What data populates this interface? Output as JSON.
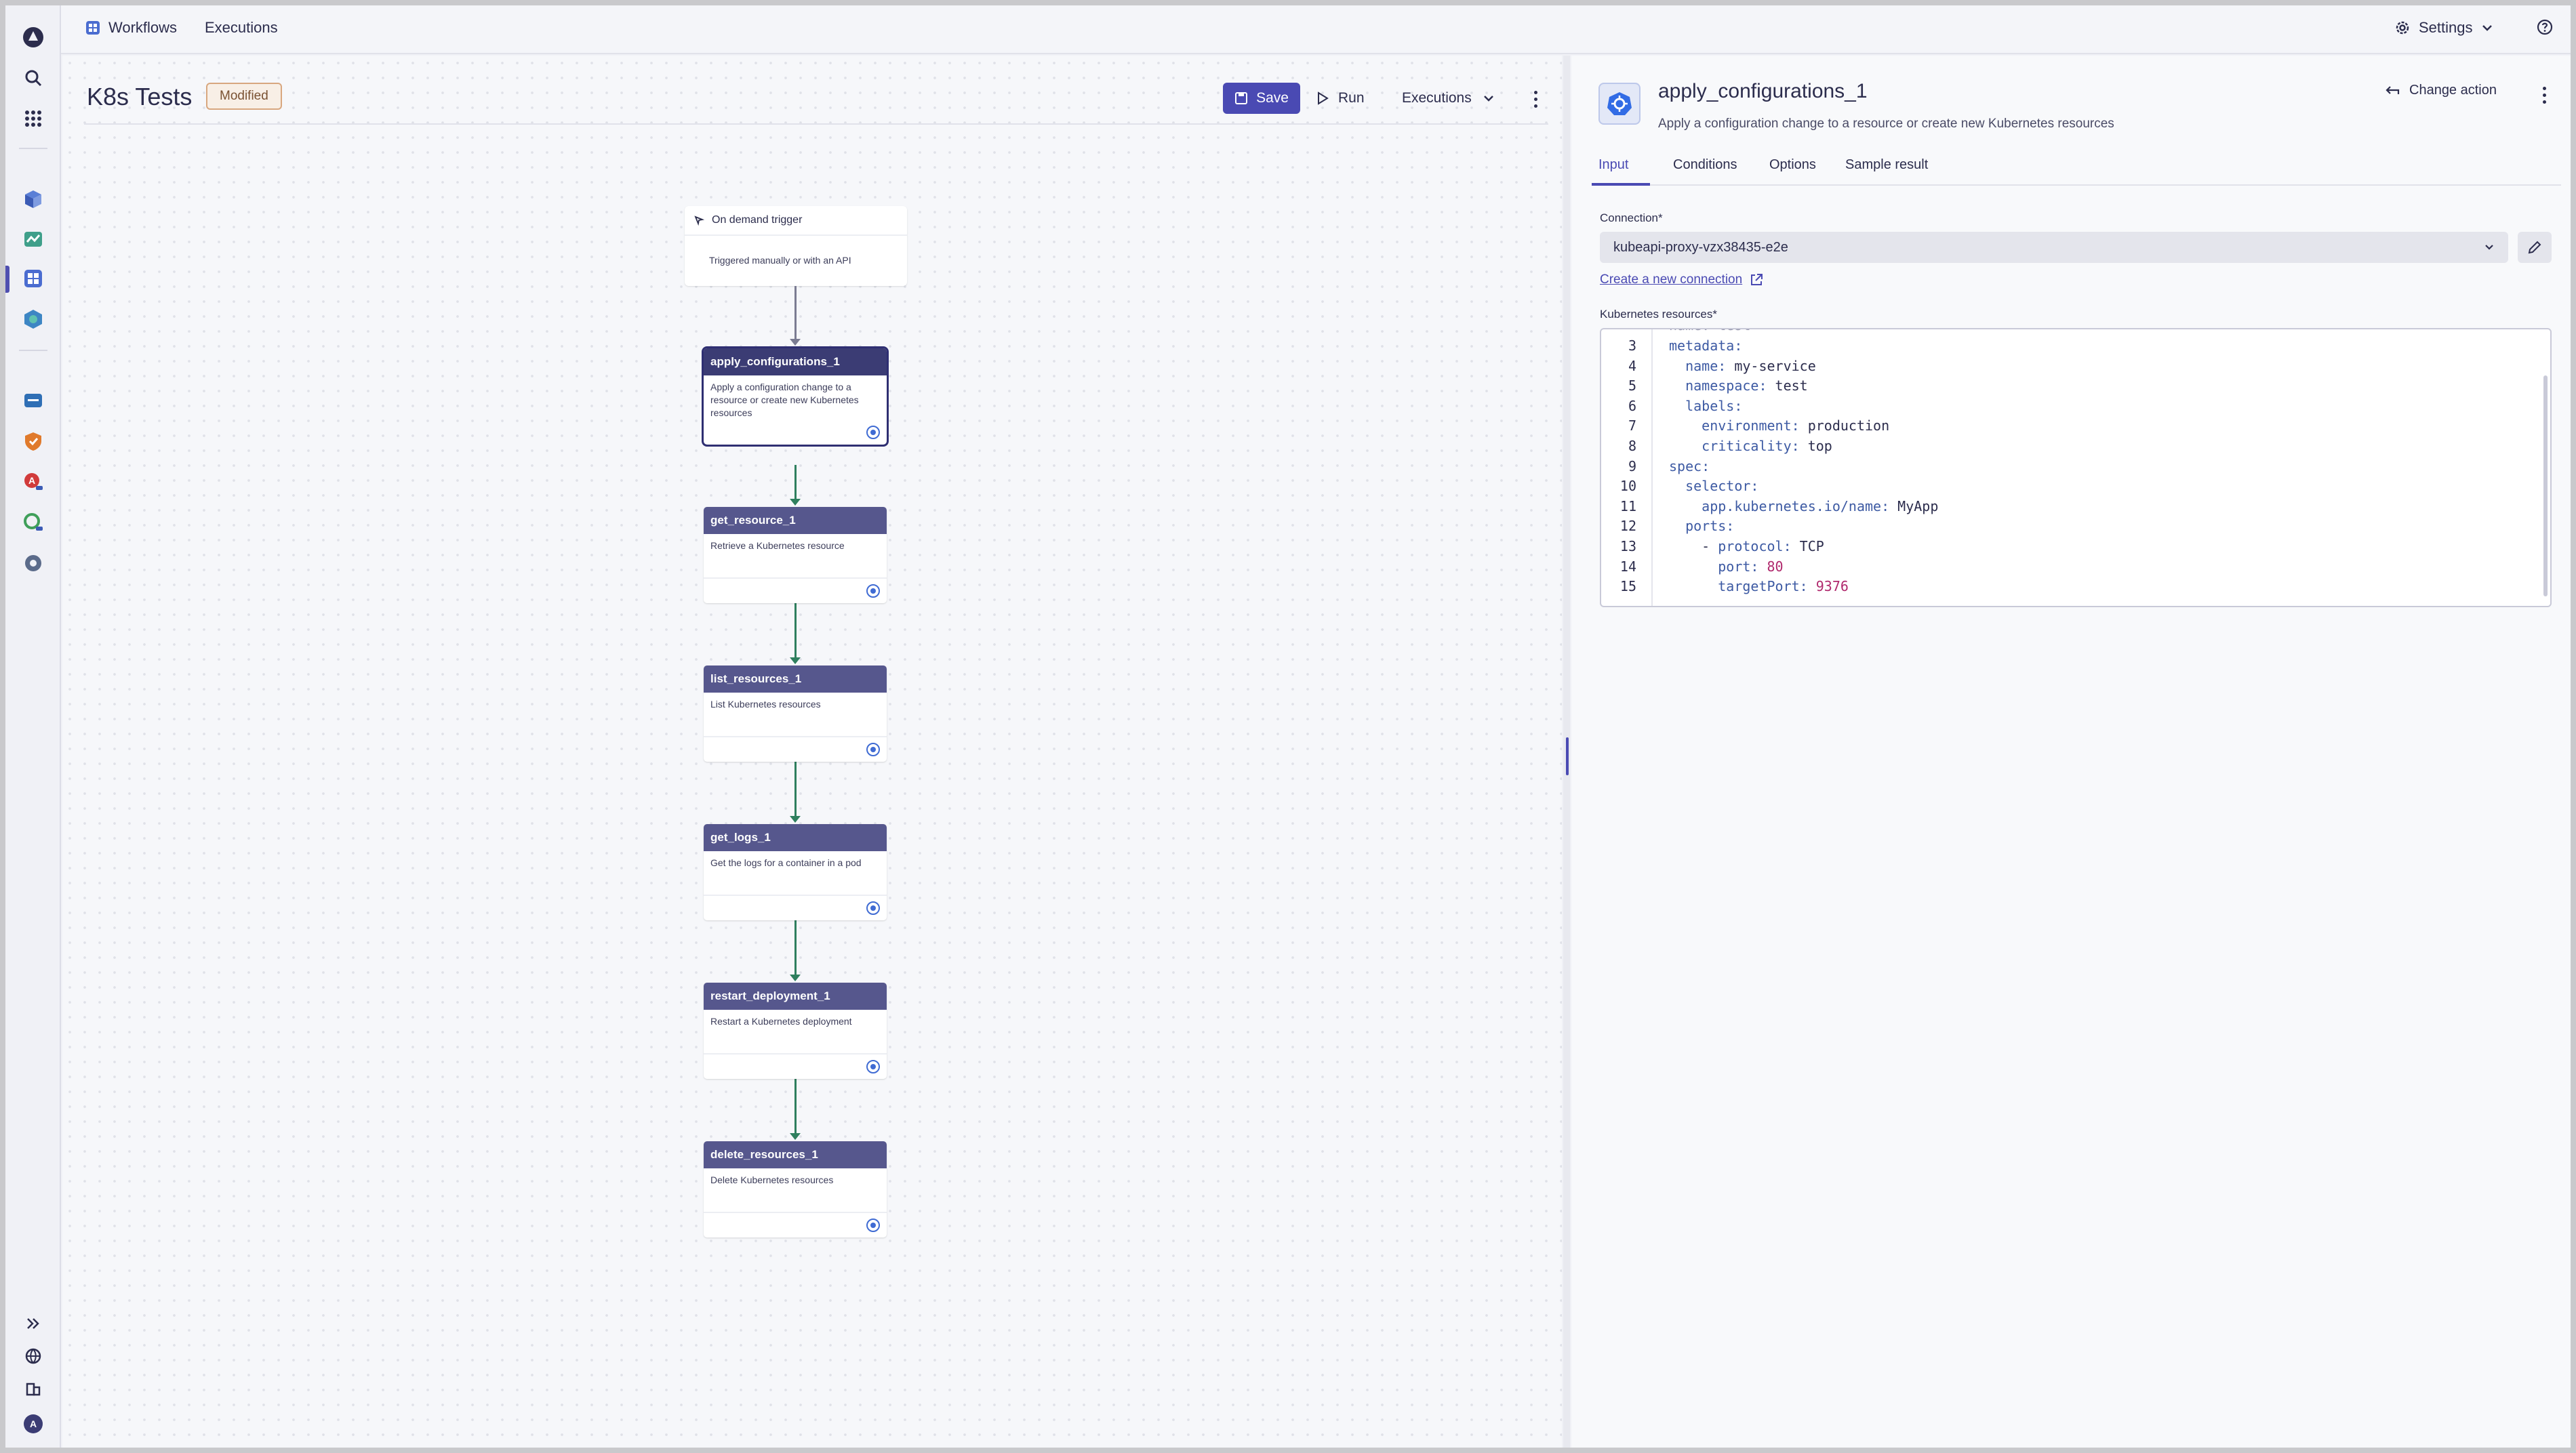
{
  "topbar": {
    "workflows": "Workflows",
    "executions": "Executions",
    "settings": "Settings"
  },
  "canvas": {
    "title": "K8s Tests",
    "badge": "Modified",
    "save": "Save",
    "run": "Run",
    "executions": "Executions"
  },
  "trigger": {
    "title": "On demand trigger",
    "description": "Triggered manually or with an API"
  },
  "nodes": [
    {
      "title": "apply_configurations_1",
      "description": "Apply a configuration change to a resource or create new Kubernetes resources"
    },
    {
      "title": "get_resource_1",
      "description": "Retrieve a Kubernetes resource"
    },
    {
      "title": "list_resources_1",
      "description": "List Kubernetes resources"
    },
    {
      "title": "get_logs_1",
      "description": "Get the logs for a container in a pod"
    },
    {
      "title": "restart_deployment_1",
      "description": "Restart a Kubernetes deployment"
    },
    {
      "title": "delete_resources_1",
      "description": "Delete Kubernetes resources"
    }
  ],
  "panel": {
    "title": "apply_configurations_1",
    "subtitle": "Apply a configuration change to a resource or create new Kubernetes resources",
    "change_action": "Change action",
    "tabs": [
      "Input",
      "Conditions",
      "Options",
      "Sample result"
    ],
    "connection_label": "Connection*",
    "connection_value": "kubeapi-proxy-vzx38435-e2e",
    "create_connection": "Create a new connection",
    "resources_label": "Kubernetes resources*",
    "line_numbers": [
      "3",
      "4",
      "5",
      "6",
      "7",
      "8",
      "9",
      "10",
      "11",
      "12",
      "13",
      "14",
      "15"
    ]
  },
  "icons": {
    "brand": "dynatrace-logo-icon",
    "accent": "#4a4ab3",
    "connector_green": "#2f7f5e"
  }
}
